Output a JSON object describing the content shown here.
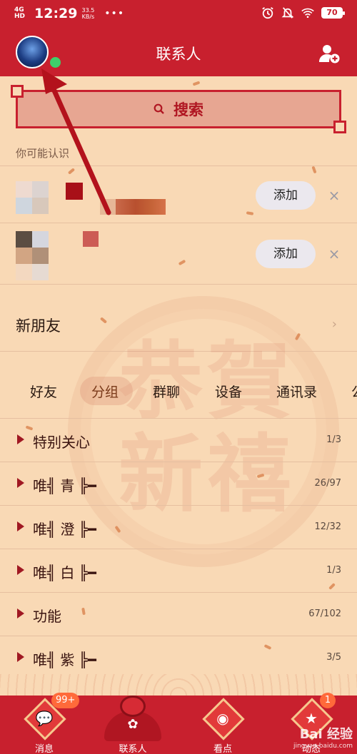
{
  "status_bar": {
    "network": "4G HD",
    "time": "12:29",
    "speed_value": "33.5",
    "speed_unit": "KB/s",
    "more": "•••",
    "battery": "70"
  },
  "header": {
    "title": "联系人"
  },
  "search": {
    "label": "搜索"
  },
  "recommend": {
    "section_label": "你可能认识",
    "items": [
      {
        "add_label": "添加",
        "close_label": "×"
      },
      {
        "add_label": "添加",
        "close_label": "×"
      }
    ]
  },
  "new_friends": {
    "label": "新朋友",
    "chevron": "›"
  },
  "tabs": [
    {
      "label": "好友"
    },
    {
      "label": "分组"
    },
    {
      "label": "群聊"
    },
    {
      "label": "设备"
    },
    {
      "label": "通讯录"
    },
    {
      "label": "公"
    }
  ],
  "groups": [
    {
      "name": "特别关心",
      "count": "1/3"
    },
    {
      "name": "唯╣ 青 ╠━",
      "count": "26/97"
    },
    {
      "name": "唯╣ 澄 ╠━",
      "count": "12/32"
    },
    {
      "name": "唯╣ 白 ╠━",
      "count": "1/3"
    },
    {
      "name": "功能",
      "count": "67/102"
    },
    {
      "name": "唯╣ 紫 ╠━",
      "count": "3/5"
    }
  ],
  "bottom_nav": [
    {
      "label": "消息",
      "badge": "99+"
    },
    {
      "label": "联系人",
      "badge": ""
    },
    {
      "label": "看点",
      "badge": ""
    },
    {
      "label": "动态",
      "badge": "1"
    }
  ],
  "watermark": {
    "brand": "Bai 经验",
    "url": "jingyan.baidu.com"
  },
  "colors": {
    "header_red": "#c8202e",
    "background": "#f9d9b5",
    "online": "#3ed06a"
  }
}
